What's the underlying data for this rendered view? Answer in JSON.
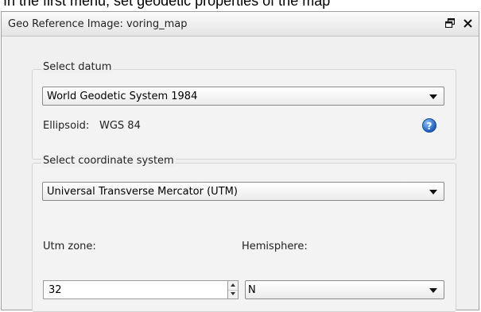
{
  "caption": "In the first menu, set geodetic properties of the map",
  "window": {
    "title": "Geo Reference Image: voring_map",
    "float_icon": "float-window-icon",
    "close_icon": "close-icon"
  },
  "datum": {
    "group_label": "Select datum",
    "selected": "World Geodetic System 1984",
    "ellipsoid_label": "Ellipsoid:",
    "ellipsoid_value": "WGS 84",
    "help_icon": "help-icon",
    "help_glyph": "?"
  },
  "coordinate_system": {
    "group_label": "Select coordinate system",
    "selected": "Universal Transverse Mercator (UTM)",
    "utm_zone_label": "Utm zone:",
    "utm_zone_value": "32",
    "hemisphere_label": "Hemisphere:",
    "hemisphere_value": "N"
  }
}
